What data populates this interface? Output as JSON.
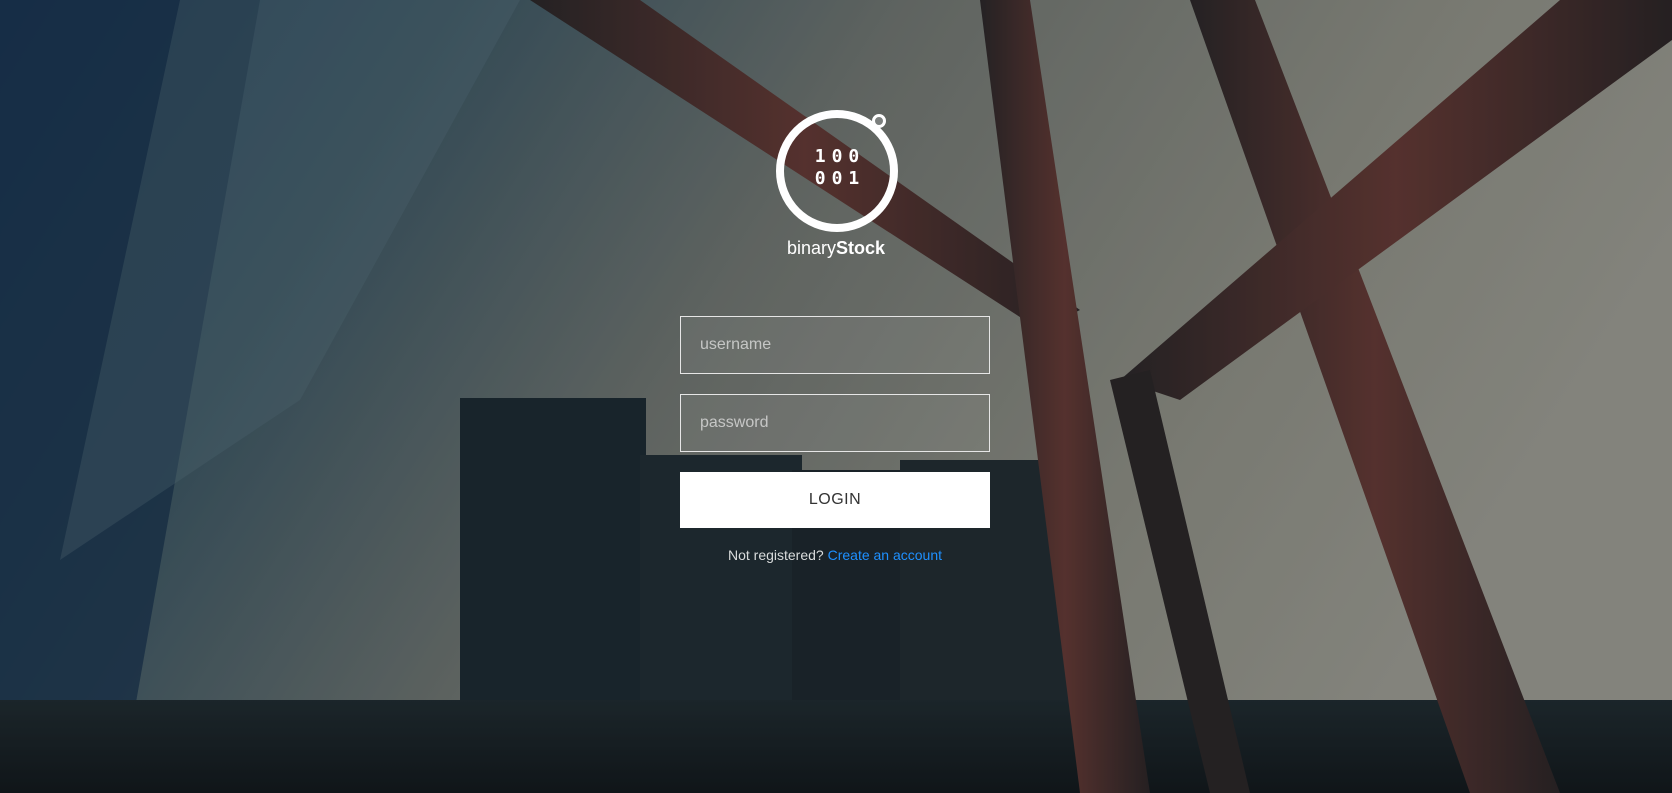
{
  "logo": {
    "digits_row1": "100",
    "digits_row2": "001",
    "brand_regular": "binary",
    "brand_bold": "Stock"
  },
  "form": {
    "username_placeholder": "username",
    "password_placeholder": "password",
    "login_label": "LOGIN"
  },
  "register": {
    "prompt": "Not registered?",
    "link_label": "Create an account"
  },
  "colors": {
    "link": "#1e90ff",
    "button_bg": "#ffffff",
    "button_text": "#333333"
  }
}
